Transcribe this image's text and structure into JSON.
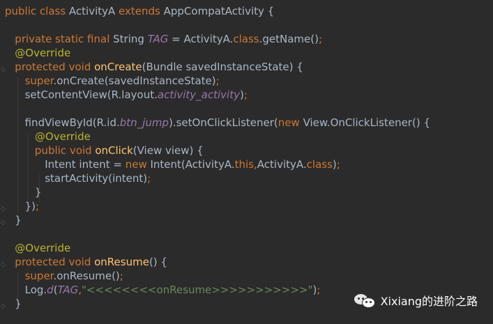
{
  "editor": {
    "lines": [
      [
        {
          "t": "public class ",
          "c": "kw"
        },
        {
          "t": "ActivityA ",
          "c": "txt"
        },
        {
          "t": "extends ",
          "c": "kw"
        },
        {
          "t": "AppCompatActivity {",
          "c": "txt"
        }
      ],
      [],
      [
        {
          "t": "   private static final ",
          "c": "kw"
        },
        {
          "t": "String ",
          "c": "txt"
        },
        {
          "t": "TAG",
          "c": "it"
        },
        {
          "t": " = ActivityA.",
          "c": "txt"
        },
        {
          "t": "class",
          "c": "kw"
        },
        {
          "t": ".getName()",
          "c": "txt"
        },
        {
          "t": ";",
          "c": "kw"
        }
      ],
      [
        {
          "t": "   @Override",
          "c": "ann"
        }
      ],
      [
        {
          "t": "   protected void ",
          "c": "kw"
        },
        {
          "t": "onCreate",
          "c": "fn"
        },
        {
          "t": "(Bundle savedInstanceState) {",
          "c": "txt"
        }
      ],
      [
        {
          "t": "      super",
          "c": "kw"
        },
        {
          "t": ".onCreate(savedInstanceState)",
          "c": "txt"
        },
        {
          "t": ";",
          "c": "kw"
        }
      ],
      [
        {
          "t": "      setContentView(R.layout.",
          "c": "txt"
        },
        {
          "t": "activity_activity",
          "c": "it"
        },
        {
          "t": ")",
          "c": "txt"
        },
        {
          "t": ";",
          "c": "kw"
        }
      ],
      [],
      [
        {
          "t": "      findViewById(R.id.",
          "c": "txt"
        },
        {
          "t": "btn_jump",
          "c": "it"
        },
        {
          "t": ").setOnClickListener(",
          "c": "txt"
        },
        {
          "t": "new ",
          "c": "kw"
        },
        {
          "t": "View.OnClickListener() {",
          "c": "txt"
        }
      ],
      [
        {
          "t": "         @Override",
          "c": "ann"
        }
      ],
      [
        {
          "t": "         public void ",
          "c": "kw"
        },
        {
          "t": "onClick",
          "c": "fn"
        },
        {
          "t": "(View view) {",
          "c": "txt"
        }
      ],
      [
        {
          "t": "            Intent intent = ",
          "c": "txt"
        },
        {
          "t": "new ",
          "c": "kw"
        },
        {
          "t": "Intent(ActivityA.",
          "c": "txt"
        },
        {
          "t": "this,",
          "c": "kw"
        },
        {
          "t": "ActivityA.",
          "c": "txt"
        },
        {
          "t": "class",
          "c": "kw"
        },
        {
          "t": ")",
          "c": "txt"
        },
        {
          "t": ";",
          "c": "kw"
        }
      ],
      [
        {
          "t": "            startActivity(intent)",
          "c": "txt"
        },
        {
          "t": ";",
          "c": "kw"
        }
      ],
      [
        {
          "t": "         }",
          "c": "txt"
        }
      ],
      [
        {
          "t": "      })",
          "c": "txt"
        },
        {
          "t": ";",
          "c": "kw"
        }
      ],
      [
        {
          "t": "   }",
          "c": "txt"
        }
      ],
      [],
      [
        {
          "t": "   @Override",
          "c": "ann"
        }
      ],
      [
        {
          "t": "   protected void ",
          "c": "kw"
        },
        {
          "t": "onResume",
          "c": "fn"
        },
        {
          "t": "() {",
          "c": "txt"
        }
      ],
      [
        {
          "t": "      super",
          "c": "kw"
        },
        {
          "t": ".onResume()",
          "c": "txt"
        },
        {
          "t": ";",
          "c": "kw"
        }
      ],
      [
        {
          "t": "      Log.",
          "c": "txt"
        },
        {
          "t": "d",
          "c": "it"
        },
        {
          "t": "(",
          "c": "txt"
        },
        {
          "t": "TAG",
          "c": "it"
        },
        {
          "t": ",",
          "c": "kw"
        },
        {
          "t": "\"<<<<<<<<onResume>>>>>>>>>>>\"",
          "c": "str"
        },
        {
          "t": ")",
          "c": "txt"
        },
        {
          "t": ";",
          "c": "kw"
        }
      ],
      [
        {
          "t": "   }",
          "c": "txt"
        }
      ]
    ]
  },
  "watermark": {
    "text": "Xixiang的进阶之路",
    "icon": "wechat-icon"
  }
}
